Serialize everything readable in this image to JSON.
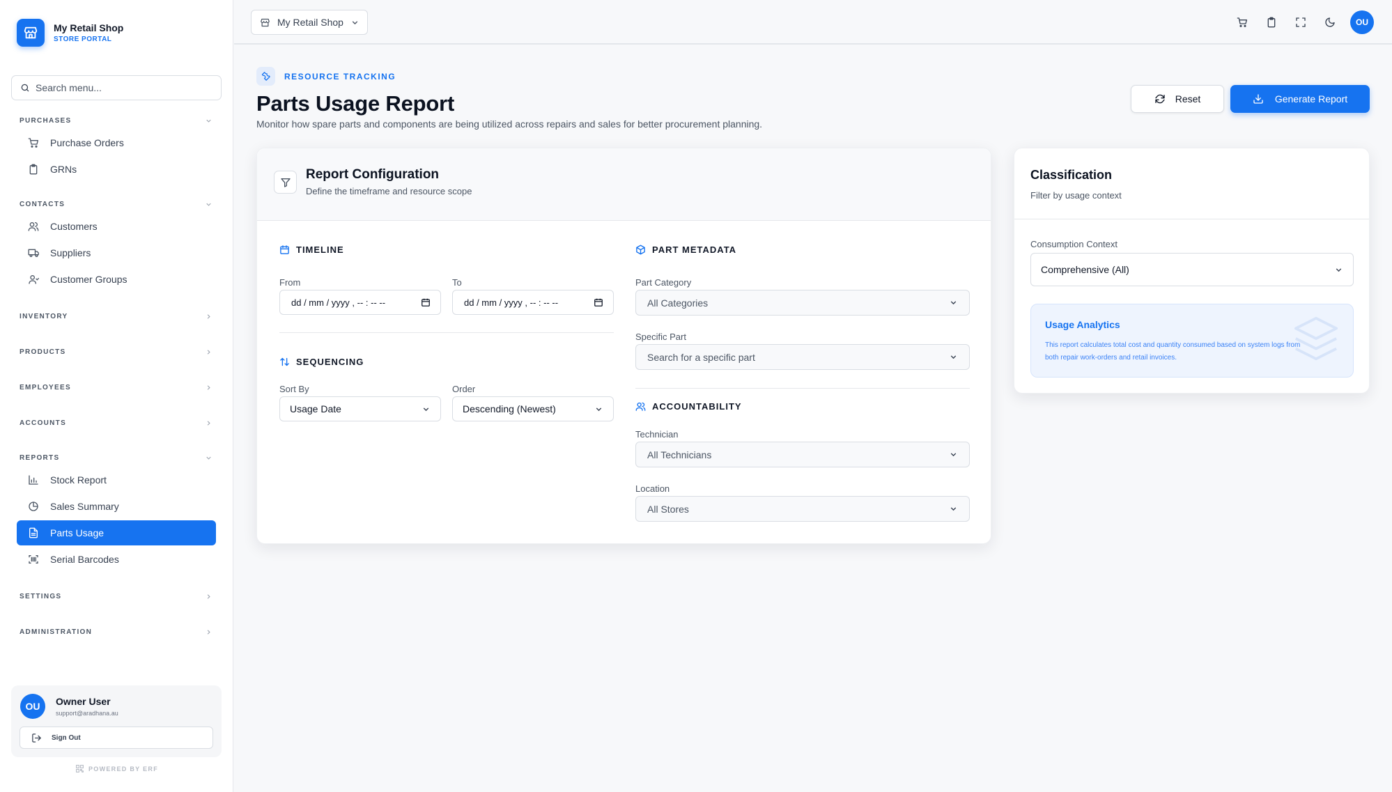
{
  "brand": {
    "name": "My Retail Shop",
    "subtitle": "STORE PORTAL"
  },
  "search": {
    "placeholder": "Search menu..."
  },
  "nav": {
    "purchases": {
      "label": "PURCHASES",
      "items": [
        "Purchase Orders",
        "GRNs"
      ]
    },
    "contacts": {
      "label": "CONTACTS",
      "items": [
        "Customers",
        "Suppliers",
        "Customer Groups"
      ]
    },
    "inventory": "INVENTORY",
    "products": "PRODUCTS",
    "employees": "EMPLOYEES",
    "accounts": "ACCOUNTS",
    "reports": {
      "label": "REPORTS",
      "items": [
        "Stock Report",
        "Sales Summary",
        "Parts Usage",
        "Serial Barcodes"
      ],
      "active": "Parts Usage"
    },
    "settings": "SETTINGS",
    "administration": "ADMINISTRATION"
  },
  "user": {
    "initials": "OU",
    "name": "Owner User",
    "email": "support@aradhana.au",
    "signout": "Sign Out"
  },
  "powered_by": "POWERED BY ERF",
  "topbar": {
    "shop_select": "My Retail Shop",
    "avatar": "OU"
  },
  "header": {
    "eyebrow": "RESOURCE TRACKING",
    "title": "Parts Usage Report",
    "description": "Monitor how spare parts and components are being utilized across repairs and sales for better procurement planning.",
    "reset_label": "Reset",
    "generate_label": "Generate Report"
  },
  "config": {
    "title": "Report Configuration",
    "subtitle": "Define the timeframe and resource scope",
    "timeline": {
      "title": "TIMELINE",
      "from_label": "From",
      "from_value": "dd / mm / yyyy ,  -- : --   --",
      "to_label": "To",
      "to_value": "dd / mm / yyyy ,  -- : --   --"
    },
    "sequencing": {
      "title": "SEQUENCING",
      "sort_label": "Sort By",
      "sort_value": "Usage Date",
      "order_label": "Order",
      "order_value": "Descending (Newest)"
    },
    "metadata": {
      "title": "PART METADATA",
      "category_label": "Part Category",
      "category_value": "All Categories",
      "part_label": "Specific Part",
      "part_value": "Search for a specific part"
    },
    "accountability": {
      "title": "ACCOUNTABILITY",
      "technician_label": "Technician",
      "technician_value": "All Technicians",
      "location_label": "Location",
      "location_value": "All Stores"
    }
  },
  "classification": {
    "title": "Classification",
    "subtitle": "Filter by usage context",
    "context_label": "Consumption Context",
    "context_value": "Comprehensive (All)",
    "analytics_title": "Usage Analytics",
    "analytics_text": "This report calculates total cost and quantity consumed based on system logs from both repair work-orders and retail invoices."
  },
  "colors": {
    "accent": "#1673f0",
    "background": "#f7f8fa",
    "text": "#111827"
  }
}
